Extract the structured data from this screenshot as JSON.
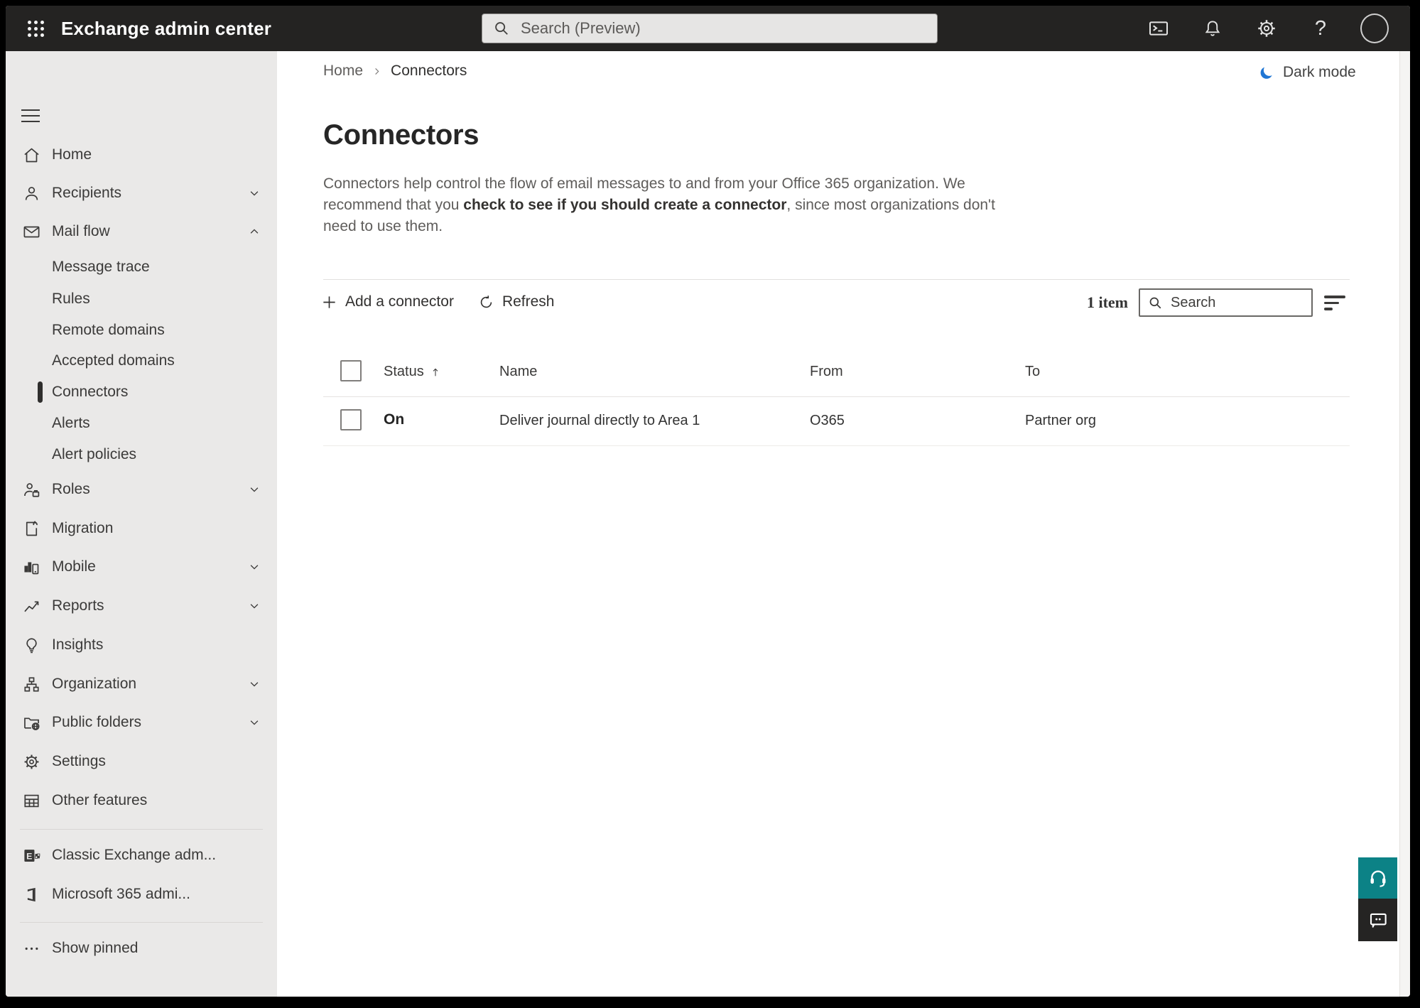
{
  "colors": {
    "accent_blue": "#2076d4",
    "help_teal": "#0c8286",
    "topbar_bg": "#242322",
    "sidebar_bg": "#eae9e8",
    "selected_marker": "#2f2e2d"
  },
  "topbar": {
    "app_title": "Exchange admin center",
    "search_placeholder": "Search (Preview)",
    "icons": [
      "app-launcher-icon",
      "terminal-icon",
      "bell-icon",
      "gear-icon",
      "help-icon",
      "avatar"
    ]
  },
  "sidebar": {
    "items": [
      {
        "key": "home",
        "label": "Home",
        "icon": "home-icon"
      },
      {
        "key": "recipients",
        "label": "Recipients",
        "icon": "person-icon",
        "chevron": "down"
      },
      {
        "key": "mail-flow",
        "label": "Mail flow",
        "icon": "mail-icon",
        "chevron": "up",
        "expanded": true
      },
      {
        "key": "message-trace",
        "label": "Message trace",
        "sub": true
      },
      {
        "key": "rules",
        "label": "Rules",
        "sub": true
      },
      {
        "key": "remote-domains",
        "label": "Remote domains",
        "sub": true
      },
      {
        "key": "accepted-domains",
        "label": "Accepted domains",
        "sub": true
      },
      {
        "key": "connectors",
        "label": "Connectors",
        "sub": true,
        "selected": true
      },
      {
        "key": "alerts",
        "label": "Alerts",
        "sub": true
      },
      {
        "key": "alert-policies",
        "label": "Alert policies",
        "sub": true
      },
      {
        "key": "roles",
        "label": "Roles",
        "icon": "roles-icon",
        "chevron": "down"
      },
      {
        "key": "migration",
        "label": "Migration",
        "icon": "migration-icon"
      },
      {
        "key": "mobile",
        "label": "Mobile",
        "icon": "mobile-icon",
        "chevron": "down"
      },
      {
        "key": "reports",
        "label": "Reports",
        "icon": "reports-icon",
        "chevron": "down"
      },
      {
        "key": "insights",
        "label": "Insights",
        "icon": "lightbulb-icon"
      },
      {
        "key": "organization",
        "label": "Organization",
        "icon": "org-chart-icon",
        "chevron": "down"
      },
      {
        "key": "public-folders",
        "label": "Public folders",
        "icon": "folder-globe-icon",
        "chevron": "down"
      },
      {
        "key": "settings",
        "label": "Settings",
        "icon": "gear-icon"
      },
      {
        "key": "other-features",
        "label": "Other features",
        "icon": "table-icon"
      },
      {
        "key": "classic-exchange",
        "label": "Classic Exchange adm...",
        "icon": "exchange-logo-icon"
      },
      {
        "key": "m365-admin",
        "label": "Microsoft 365 admi...",
        "icon": "microsoft-365-logo-icon"
      },
      {
        "key": "show-pinned",
        "label": "Show pinned",
        "icon": "ellipsis-icon"
      }
    ]
  },
  "breadcrumb": {
    "home": "Home",
    "current": "Connectors"
  },
  "dark_mode": {
    "label": "Dark mode",
    "icon": "moon-icon"
  },
  "page": {
    "title": "Connectors",
    "description_lines": [
      {
        "pre": "Connectors help control the flow of email messages to and from your Office 365 organization. We"
      },
      {
        "pre": "recommend that you ",
        "bold": "check to see if you should create a connector",
        "post": ", since most organizations don't"
      },
      {
        "pre": "need to use them."
      }
    ]
  },
  "toolbar": {
    "add_connector_label": "Add a connector",
    "refresh_label": "Refresh",
    "count_label": "1 item",
    "search_placeholder": "Search",
    "filter_icon": "filter-icon"
  },
  "table": {
    "columns": [
      {
        "key": "status",
        "label": "Status",
        "sorted": "asc"
      },
      {
        "key": "name",
        "label": "Name"
      },
      {
        "key": "from",
        "label": "From"
      },
      {
        "key": "to",
        "label": "To"
      }
    ],
    "rows": [
      {
        "status": "On",
        "name": "Deliver journal directly to Area 1",
        "from": "O365",
        "to": "Partner org"
      }
    ]
  },
  "help_widget": {
    "buttons": [
      {
        "name": "help-button",
        "icon": "headset-icon"
      },
      {
        "name": "feedback-button",
        "icon": "feedback-icon"
      }
    ]
  }
}
